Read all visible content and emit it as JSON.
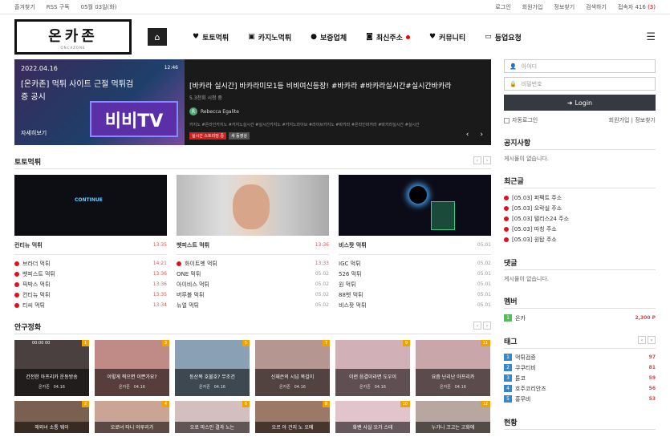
{
  "util": {
    "left": [
      "즐겨찾기",
      "RSS 구독",
      "05월 03일(화)"
    ],
    "right": [
      "로그인",
      "회원가입",
      "정보찾기",
      "검색하기"
    ],
    "visitors_label": "접속자 416",
    "visitors_count": "(3)"
  },
  "logo": {
    "main": "온카존",
    "sub": "ONCAZONE"
  },
  "nav": [
    {
      "label": "토토먹튀",
      "icon": "heart-icon"
    },
    {
      "label": "카지노먹튀",
      "icon": "image-icon"
    },
    {
      "label": "보증업체",
      "icon": "soccer-ball-icon"
    },
    {
      "label": "최신주소",
      "icon": "camera-icon"
    },
    {
      "label": "커뮤니티",
      "icon": "heart-icon"
    },
    {
      "label": "등업요청",
      "icon": "monitor-icon"
    }
  ],
  "slider": {
    "date": "2022.04.16",
    "duration": "12:46",
    "caption": "[온카존] 먹튀 사이트 근절 먹튀검증 공시",
    "more": "자세히보기",
    "tv_text": "비비TV",
    "title": "[바카라 실시간] 바카라미모1등 비비여신등장! #바카라 #바카라실시간#실시간바카라",
    "views": "5.3천회 시청 중",
    "author_initial": "R",
    "author": "Rebecca Egalite",
    "tags": "카지노 #온라인카지노 #카지노실시간 #실시간카지노 #카지노라이브 #라이브카지노 #바카라 #온라인바카라 #바카라실시간 #실시간",
    "badge1": "실시간 스트리밍 중",
    "badge2": "새 동영상",
    "prev": "‹",
    "next": "›"
  },
  "toto": {
    "title": "토토먹튀",
    "cards": [
      {
        "head": "컨티뉴 먹튀",
        "head_time": "13:35",
        "thumb_text": "CONTINUE",
        "items": [
          {
            "name": "브라더 먹튀",
            "time": "14:21",
            "dot": true
          },
          {
            "name": "벳피스트 먹튀",
            "time": "13:36",
            "dot": true
          },
          {
            "name": "픽박스 먹튀",
            "time": "13:36",
            "dot": true
          },
          {
            "name": "컨티뉴 먹튀",
            "time": "13:35",
            "dot": true
          },
          {
            "name": "티씨 먹튀",
            "time": "13:34",
            "dot": true
          }
        ]
      },
      {
        "head": "벳피스트 먹튀",
        "head_time": "13:36",
        "thumb_text": "",
        "items": [
          {
            "name": "화이트벳 먹튀",
            "time": "13:33",
            "dot": true
          },
          {
            "name": "ONE 먹튀",
            "time": "05.02",
            "dot": false
          },
          {
            "name": "아이비스 먹튀",
            "time": "05.02",
            "dot": false
          },
          {
            "name": "버루볼 먹튀",
            "time": "05.02",
            "dot": false
          },
          {
            "name": "뉴얼 먹튀",
            "time": "05.02",
            "dot": false
          }
        ]
      },
      {
        "head": "비스팟 먹튀",
        "head_time": "05.01",
        "thumb_text": "",
        "items": [
          {
            "name": "IGC 먹튀",
            "time": "05.02",
            "dot": false
          },
          {
            "name": "526 먹튀",
            "time": "05.01",
            "dot": false
          },
          {
            "name": "원 먹튀",
            "time": "05.01",
            "dot": false
          },
          {
            "name": "88벳 먹튀",
            "time": "05.01",
            "dot": false
          },
          {
            "name": "비스팟 먹튀",
            "time": "05.01",
            "dot": false
          }
        ]
      }
    ]
  },
  "safety": {
    "title": "안구정화",
    "row1": [
      {
        "num": "1",
        "title": "건전한 아프리카 운동방송",
        "author": "온카존",
        "date": "04.16",
        "views": "00:00 00",
        "color": "#4a4040"
      },
      {
        "num": "3",
        "title": "이렇게 찍으면 이쁜가요?",
        "author": "온카존",
        "date": "04.16",
        "views": "",
        "color": "#c08a86"
      },
      {
        "num": "5",
        "title": "등산복 호불호? 무조건",
        "author": "온카존",
        "date": "04.16",
        "views": "",
        "color": "#8aa0b4"
      },
      {
        "num": "7",
        "title": "신재은의 시넘 목걸이",
        "author": "온카존",
        "date": "04.16",
        "views": "",
        "color": "#b59690"
      },
      {
        "num": "9",
        "title": "이런 음결이라면 도우이",
        "author": "온카존",
        "date": "04.16",
        "views": "",
        "color": "#d2b0b8"
      },
      {
        "num": "11",
        "title": "요즘 난리난 아프리카",
        "author": "온카존",
        "date": "04.16",
        "views": "",
        "color": "#c9a6aa"
      }
    ],
    "row2": [
      {
        "num": "2",
        "title": "해외녀 소통 웨이",
        "color": "#7a6050"
      },
      {
        "num": "4",
        "title": "오로녀 타니 이루리가",
        "color": "#caa596"
      },
      {
        "num": "6",
        "title": "오로 마스인 결과 노는",
        "color": "#d4bfbf"
      },
      {
        "num": "8",
        "title": "오르 아 건지 노 오메",
        "color": "#9c7866"
      },
      {
        "num": "10",
        "title": "화밴 사실 오가 스테",
        "color": "#e2c4cc"
      },
      {
        "num": "12",
        "title": "누가니 끄고는 고화에",
        "color": "#b7a7a0"
      }
    ]
  },
  "side": {
    "id_placeholder": "아이디",
    "pw_placeholder": "비밀번호",
    "login": "Login",
    "auto_login": "자동로그인",
    "join": "회원가입",
    "find": "정보찾기",
    "notice_title": "공지사항",
    "notice_empty": "게시물이 없습니다.",
    "recent_title": "최근글",
    "recent": [
      "[05.03] 퍼팩트 주소",
      "[05.03] 오락실 주소",
      "[05.03] 텔리스24 주소",
      "[05.03] 따칭 주소",
      "[05.03] 원탑 주소"
    ],
    "comment_title": "댓글",
    "comment_empty": "게시물이 없습니다.",
    "member_title": "멤버",
    "members": [
      {
        "rank": "1",
        "name": "온카",
        "value": "2,300 P"
      }
    ],
    "tag_title": "태그",
    "tags": [
      {
        "rank": "1",
        "name": "먹튀검증",
        "value": "97"
      },
      {
        "rank": "2",
        "name": "쿠쿠티비",
        "value": "81"
      },
      {
        "rank": "3",
        "name": "튠코",
        "value": "59"
      },
      {
        "rank": "4",
        "name": "호주코리안즈",
        "value": "56"
      },
      {
        "rank": "5",
        "name": "홍무비",
        "value": "53"
      }
    ],
    "status_title": "현황"
  },
  "colors": {
    "accent_red": "#d12020",
    "login_btn": "#343a40",
    "rank_green": "#5cb85c",
    "rank_blue": "#3a87c8"
  }
}
